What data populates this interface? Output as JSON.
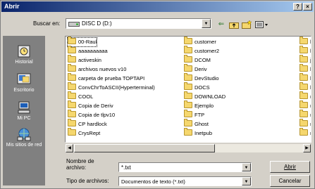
{
  "window": {
    "title": "Abrir",
    "help_label": "?",
    "close_label": "×"
  },
  "toolbar": {
    "look_in_label": "Buscar en:",
    "look_in_value": "DISC D (D:)",
    "icons": [
      "back-icon",
      "up-folder-icon",
      "new-folder-icon",
      "views-menu-icon"
    ]
  },
  "places": [
    {
      "label": "Historial",
      "icon": "history-icon"
    },
    {
      "label": "Escritorio",
      "icon": "desktop-icon"
    },
    {
      "label": "Mi PC",
      "icon": "my-computer-icon"
    },
    {
      "label": "Mis sitios de red",
      "icon": "network-places-icon"
    }
  ],
  "files": {
    "col1": [
      "00-Raul",
      "aaaaaaaaaa",
      "activeskin",
      "archivos nuevos v10",
      "carpeta de prueba TOPTAPI",
      "ConvChrToASCII(Hyperterminal)",
      "COOL",
      "Copia de Deriv",
      "Copia de tlpv10",
      "CP hardlock",
      "CrysRept"
    ],
    "col2": [
      "customer",
      "customer2",
      "DCOM",
      "Deriv",
      "DevStudio",
      "DOCS",
      "DOWNLOAD",
      "Ejemplo",
      "FTP",
      "Ghost",
      "Inetpub"
    ],
    "col3": [
      "l",
      "l",
      "j",
      "l",
      "l",
      "l",
      "r",
      "r",
      "r",
      "r",
      "r"
    ]
  },
  "form": {
    "filename_label": "Nombre de archivo:",
    "filename_value": "*.txt",
    "filetype_label": "Tipo de archivos:",
    "filetype_value": "Documentos de texto (*.txt)"
  },
  "buttons": {
    "open": "Abrir",
    "cancel": "Cancelar"
  }
}
